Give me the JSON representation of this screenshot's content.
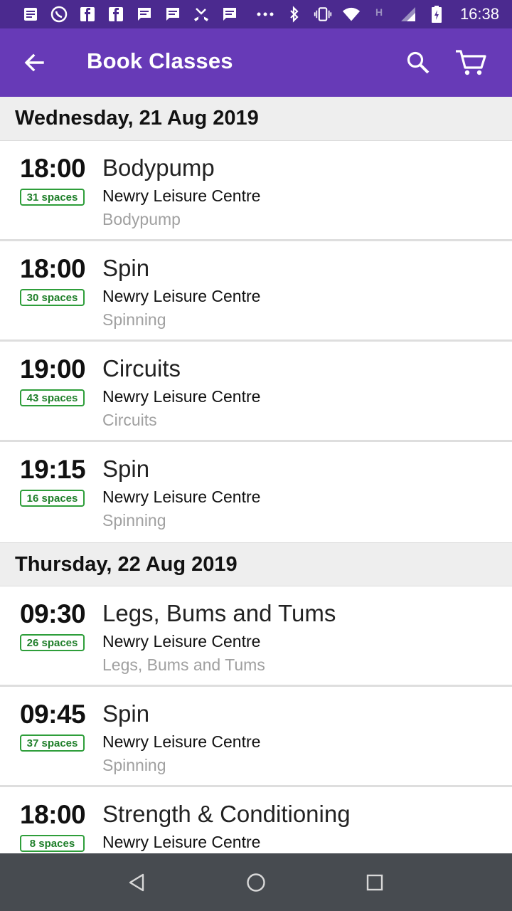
{
  "status_bar": {
    "time": "16:38",
    "left_icons": [
      "notes-icon",
      "whatsapp-icon",
      "facebook-icon",
      "facebook-icon",
      "message-icon",
      "message-icon",
      "missed-call-icon",
      "message-icon",
      "more-dots-icon"
    ],
    "right_icons": [
      "bluetooth-icon",
      "vibrate-icon",
      "wifi-icon",
      "network-h-icon",
      "signal-icon",
      "battery-charging-icon"
    ]
  },
  "app_bar": {
    "title": "Book Classes",
    "color": "#673ab7"
  },
  "days": [
    {
      "date": "Wednesday, 21 Aug 2019",
      "classes": [
        {
          "time": "18:00",
          "spaces": "31 spaces",
          "name": "Bodypump",
          "venue": "Newry Leisure Centre",
          "category": "Bodypump"
        },
        {
          "time": "18:00",
          "spaces": "30 spaces",
          "name": "Spin",
          "venue": "Newry Leisure Centre",
          "category": "Spinning"
        },
        {
          "time": "19:00",
          "spaces": "43 spaces",
          "name": "Circuits",
          "venue": "Newry Leisure Centre",
          "category": "Circuits"
        },
        {
          "time": "19:15",
          "spaces": "16 spaces",
          "name": "Spin",
          "venue": "Newry Leisure Centre",
          "category": "Spinning"
        }
      ]
    },
    {
      "date": "Thursday, 22 Aug 2019",
      "classes": [
        {
          "time": "09:30",
          "spaces": "26 spaces",
          "name": "Legs, Bums and Tums",
          "venue": "Newry Leisure Centre",
          "category": "Legs, Bums and Tums"
        },
        {
          "time": "09:45",
          "spaces": "37 spaces",
          "name": "Spin",
          "venue": "Newry Leisure Centre",
          "category": "Spinning"
        },
        {
          "time": "18:00",
          "spaces": "8 spaces",
          "name": "Strength & Conditioning",
          "venue": "Newry Leisure Centre",
          "category": ""
        }
      ]
    }
  ],
  "colors": {
    "spaces_badge": "#2e9e3a",
    "day_header_bg": "#eeeeee",
    "nav_bar_bg": "#474b50"
  }
}
